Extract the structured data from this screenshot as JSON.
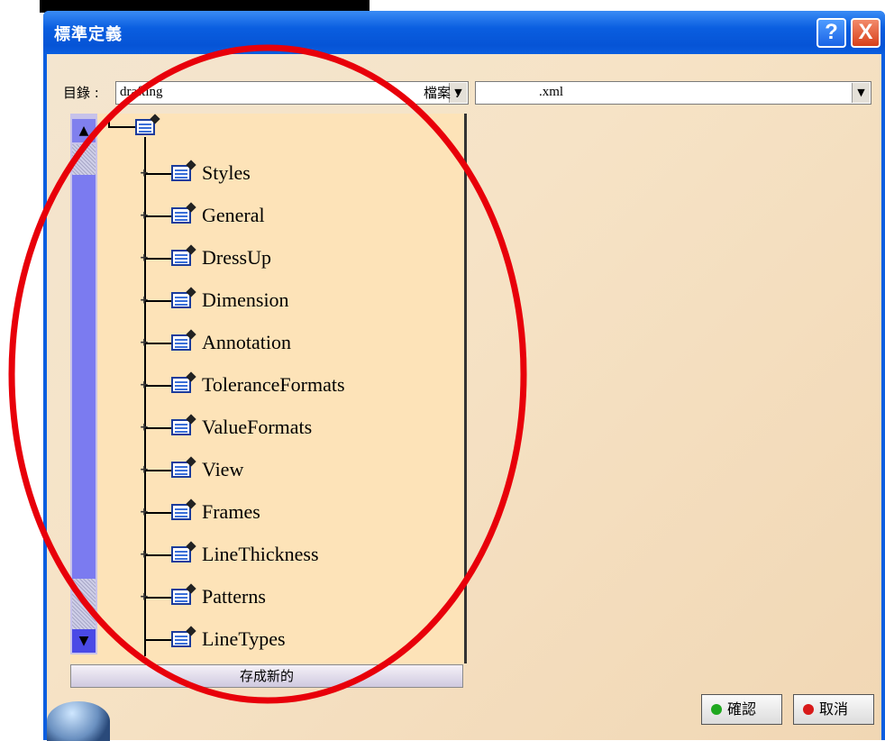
{
  "window": {
    "title": "標準定義",
    "help_label": "?",
    "close_label": "X"
  },
  "directory": {
    "label": "目錄 :",
    "value": "drafting"
  },
  "file": {
    "label": "檔案 :",
    "value": ".xml"
  },
  "tree": {
    "items": [
      {
        "label": "Styles"
      },
      {
        "label": "General"
      },
      {
        "label": "DressUp"
      },
      {
        "label": "Dimension"
      },
      {
        "label": "Annotation"
      },
      {
        "label": "ToleranceFormats"
      },
      {
        "label": "ValueFormats"
      },
      {
        "label": "View"
      },
      {
        "label": "Frames"
      },
      {
        "label": "LineThickness"
      },
      {
        "label": "Patterns"
      },
      {
        "label": "LineTypes"
      }
    ]
  },
  "buttons": {
    "save_new": "存成新的",
    "ok": "確認",
    "cancel": "取消"
  },
  "colors": {
    "annotation_ellipse": "#e8000a",
    "titlebar": "#0a5ee0",
    "ok_dot": "#1fa81f",
    "cancel_dot": "#d81a1a"
  }
}
